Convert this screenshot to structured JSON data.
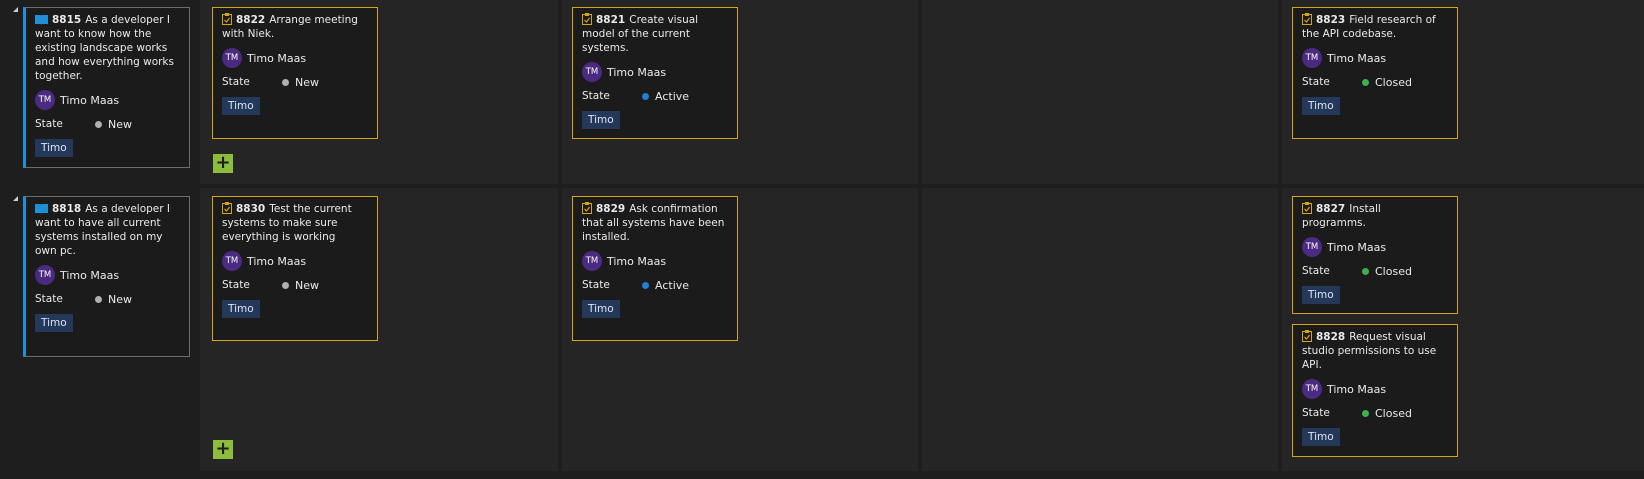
{
  "colors": {
    "story_accent": "#1e90d6",
    "task_border": "#d4a50e",
    "state_new": "#b0b0b0",
    "state_active": "#1e7fd4",
    "state_closed": "#3fb04f",
    "tag_bg": "#24385a",
    "avatar_bg": "#4b2a82",
    "add_button": "#8dbb3c"
  },
  "state_label": "State",
  "rows": [
    {
      "story": {
        "id": "8815",
        "title": "As a developer I want to know how the existing landscape works and how everything works together.",
        "assignee_initials": "TM",
        "assignee": "Timo Maas",
        "state": "New",
        "tag": "Timo",
        "icon": "book-icon"
      },
      "tasks": {
        "new": [
          {
            "id": "8822",
            "title": "Arrange meeting with Niek.",
            "assignee_initials": "TM",
            "assignee": "Timo Maas",
            "state": "New",
            "tag": "Timo"
          }
        ],
        "active": [
          {
            "id": "8821",
            "title": "Create visual model of the current systems.",
            "assignee_initials": "TM",
            "assignee": "Timo Maas",
            "state": "Active",
            "tag": "Timo"
          }
        ],
        "closed": [
          {
            "id": "8823",
            "title": "Field research of the API codebase.",
            "assignee_initials": "TM",
            "assignee": "Timo Maas",
            "state": "Closed",
            "tag": "Timo"
          }
        ]
      }
    },
    {
      "story": {
        "id": "8818",
        "title": "As a developer I want to have all current systems installed on my own pc.",
        "assignee_initials": "TM",
        "assignee": "Timo Maas",
        "state": "New",
        "tag": "Timo",
        "icon": "book-icon"
      },
      "tasks": {
        "new": [
          {
            "id": "8830",
            "title": "Test the current systems to make sure everything is working",
            "assignee_initials": "TM",
            "assignee": "Timo Maas",
            "state": "New",
            "tag": "Timo"
          }
        ],
        "active": [
          {
            "id": "8829",
            "title": "Ask confirmation that all systems have been installed.",
            "assignee_initials": "TM",
            "assignee": "Timo Maas",
            "state": "Active",
            "tag": "Timo"
          }
        ],
        "closed": [
          {
            "id": "8827",
            "title": "Install programms.",
            "assignee_initials": "TM",
            "assignee": "Timo Maas",
            "state": "Closed",
            "tag": "Timo"
          },
          {
            "id": "8828",
            "title": "Request visual studio permissions to use API.",
            "assignee_initials": "TM",
            "assignee": "Timo Maas",
            "state": "Closed",
            "tag": "Timo"
          }
        ]
      }
    }
  ],
  "add_button_label": "+"
}
